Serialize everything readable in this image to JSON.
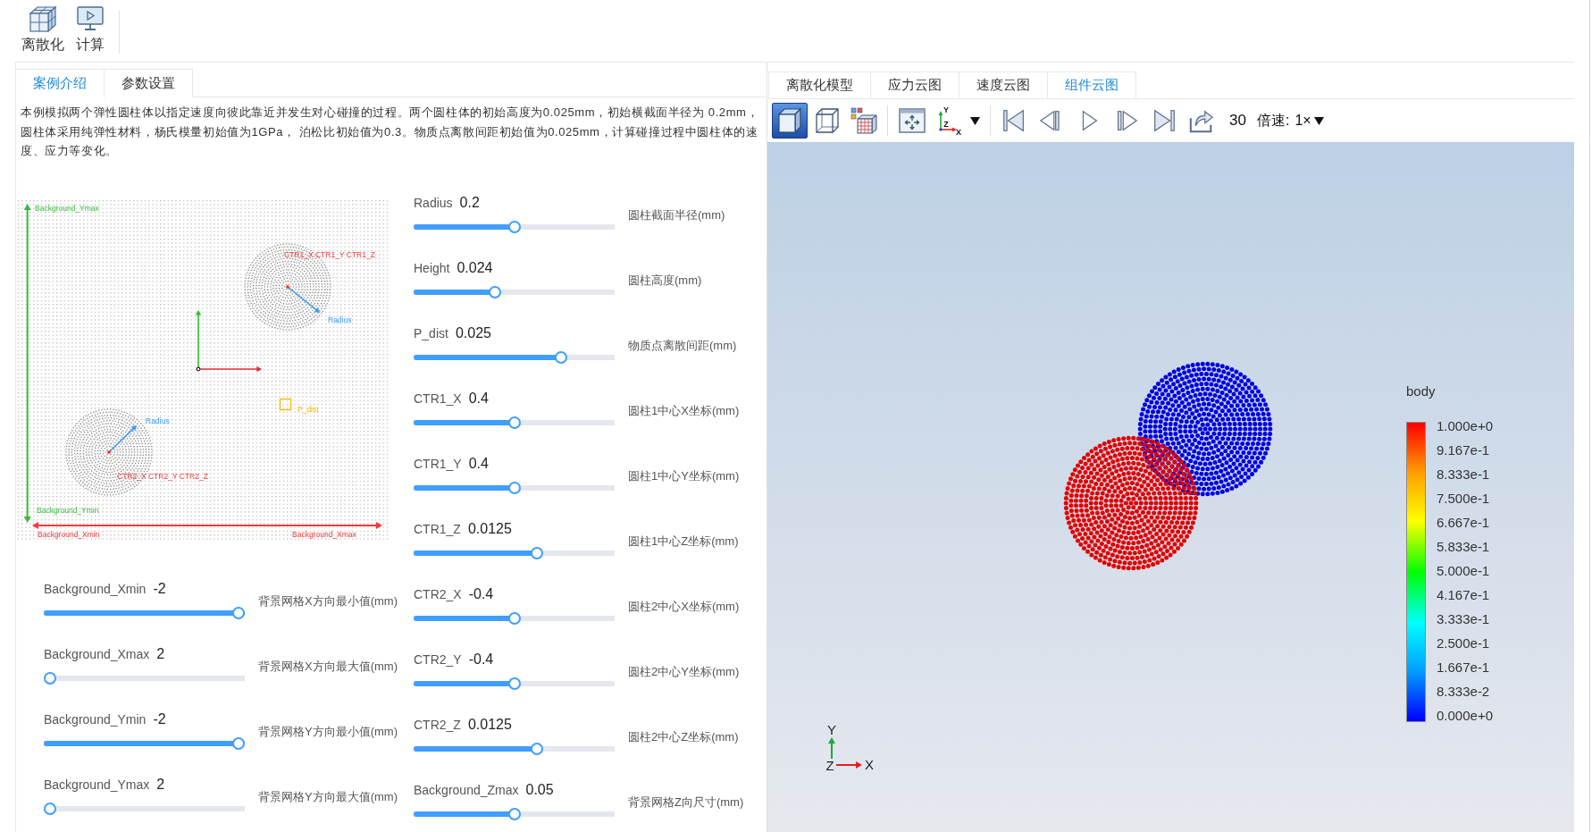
{
  "toolbar": {
    "buttons": [
      {
        "label": "离散化"
      },
      {
        "label": "计算"
      }
    ]
  },
  "left_panel": {
    "tabs": [
      {
        "label": "案例介绍",
        "selected": true
      },
      {
        "label": "参数设置",
        "selected": false
      }
    ],
    "description": "本例模拟两个弹性圆柱体以指定速度向彼此靠近并发生对心碰撞的过程。两个圆柱体的初始高度为0.025mm，初始横截面半径为 0.2mm，圆柱体采用纯弹性材料，杨氏模量初始值为1GPa， 泊松比初始值为0.3。物质点离散间距初始值为0.025mm，计算碰撞过程中圆柱体的速度、应力等变化。",
    "diagram": {
      "y_max_label": "Background_Ymax",
      "center1_label": "CTR1_X CTR1_Y CTR1_Z",
      "radius1_label": "Radius",
      "spacing_label": "P_dist",
      "radius2_label": "Radius",
      "center2_label": "CTR2_X CTR2_Y CTR2_Z",
      "y_min_label": "Background_Ymin",
      "x_min_label": "Background_Xmin",
      "x_max_label": "Background_Xmax"
    },
    "left_column_parameters": [
      {
        "name": "Background_Xmin",
        "value": "-2",
        "level": 1,
        "description": "背景网格X方向最小值(mm)"
      },
      {
        "name": "Background_Xmax",
        "value": "2",
        "level": 0,
        "description": "背景网格X方向最大值(mm)"
      },
      {
        "name": "Background_Ymin",
        "value": "-2",
        "level": 1,
        "description": "背景网格Y方向最小值(mm)"
      },
      {
        "name": "Background_Ymax",
        "value": "2",
        "level": 0,
        "description": "背景网格Y方向最大值(mm)"
      }
    ],
    "right_column_parameters": [
      {
        "name": "Radius",
        "value": "0.2",
        "level": 0.5,
        "description": "圆柱截面半径(mm)"
      },
      {
        "name": "Height",
        "value": "0.024",
        "level": 0.4,
        "description": "圆柱高度(mm)"
      },
      {
        "name": "P_dist",
        "value": "0.025",
        "level": 0.75,
        "description": "物质点离散间距(mm)"
      },
      {
        "name": "CTR1_X",
        "value": "0.4",
        "level": 0.5,
        "description": "圆柱1中心X坐标(mm)"
      },
      {
        "name": "CTR1_Y",
        "value": "0.4",
        "level": 0.5,
        "description": "圆柱1中心Y坐标(mm)"
      },
      {
        "name": "CTR1_Z",
        "value": "0.0125",
        "level": 0.62,
        "description": "圆柱1中心Z坐标(mm)"
      },
      {
        "name": "CTR2_X",
        "value": "-0.4",
        "level": 0.5,
        "description": "圆柱2中心X坐标(mm)"
      },
      {
        "name": "CTR2_Y",
        "value": "-0.4",
        "level": 0.5,
        "description": "圆柱2中心Y坐标(mm)"
      },
      {
        "name": "CTR2_Z",
        "value": "0.0125",
        "level": 0.62,
        "description": "圆柱2中心Z坐标(mm)"
      },
      {
        "name": "Background_Zmax",
        "value": "0.05",
        "level": 0.5,
        "description": "背景网格Z向尺寸(mm)"
      }
    ]
  },
  "right_panel": {
    "tabs": [
      {
        "label": "离散化模型",
        "selected": false
      },
      {
        "label": "应力云图",
        "selected": false
      },
      {
        "label": "速度云图",
        "selected": false
      },
      {
        "label": "组件云图",
        "selected": true
      }
    ],
    "toolbar": {
      "view_buttons": [
        {
          "selected": true
        },
        {
          "selected": false
        },
        {
          "selected": false
        }
      ],
      "axis_labels": [
        "Y",
        "Z",
        "X"
      ],
      "frame": "30",
      "speed_label": "倍速:",
      "speed_value": "1×"
    },
    "viewport": {
      "bodies": [
        {
          "color": "#0000e0"
        },
        {
          "color": "#e00000"
        }
      ],
      "legend": {
        "title": "body",
        "labels": [
          "1.000e+0",
          "9.167e-1",
          "8.333e-1",
          "7.500e-1",
          "6.667e-1",
          "5.833e-1",
          "5.000e-1",
          "4.167e-1",
          "3.333e-1",
          "2.500e-1",
          "1.667e-1",
          "8.333e-2",
          "0.000e+0"
        ]
      },
      "axes": {
        "y_label": "Y",
        "z_label": "Z",
        "x_label": "X"
      }
    }
  }
}
